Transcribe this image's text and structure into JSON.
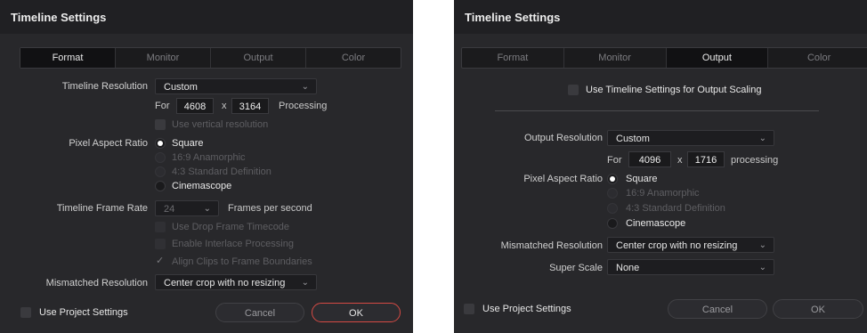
{
  "left": {
    "title": "Timeline Settings",
    "tabs": [
      "Format",
      "Monitor",
      "Output",
      "Color"
    ],
    "active_tab": "Format",
    "timeline_resolution": {
      "label": "Timeline Resolution",
      "value": "Custom"
    },
    "for_label": "For",
    "width": "4608",
    "x": "x",
    "height": "3164",
    "processing_label": "Processing",
    "vertical_resolution": "Use vertical resolution",
    "pixel_aspect": {
      "label": "Pixel Aspect Ratio",
      "options": [
        "Square",
        "16:9 Anamorphic",
        "4:3 Standard Definition",
        "Cinemascope"
      ],
      "selected": "Square"
    },
    "frame_rate": {
      "label": "Timeline Frame Rate",
      "value": "24",
      "unit": "Frames per second"
    },
    "drop_frame": "Use Drop Frame Timecode",
    "interlace": "Enable Interlace Processing",
    "align_clips": "Align Clips to Frame Boundaries",
    "mismatched": {
      "label": "Mismatched Resolution",
      "value": "Center crop with no resizing"
    },
    "use_project": "Use Project Settings",
    "cancel": "Cancel",
    "ok": "OK"
  },
  "right": {
    "title": "Timeline Settings",
    "tabs": [
      "Format",
      "Monitor",
      "Output",
      "Color"
    ],
    "active_tab": "Output",
    "use_timeline_settings": "Use Timeline Settings for Output Scaling",
    "output_resolution": {
      "label": "Output Resolution",
      "value": "Custom"
    },
    "for_label": "For",
    "width": "4096",
    "x": "x",
    "height": "1716",
    "processing_label": "processing",
    "pixel_aspect": {
      "label": "Pixel Aspect Ratio",
      "options": [
        "Square",
        "16:9 Anamorphic",
        "4:3 Standard Definition",
        "Cinemascope"
      ],
      "selected": "Square"
    },
    "mismatched": {
      "label": "Mismatched Resolution",
      "value": "Center crop with no resizing"
    },
    "super_scale": {
      "label": "Super Scale",
      "value": "None"
    },
    "use_project": "Use Project Settings",
    "cancel": "Cancel",
    "ok": "OK"
  },
  "icons": {
    "chevron": "chevron-down-icon",
    "check": "checkmark-icon"
  }
}
